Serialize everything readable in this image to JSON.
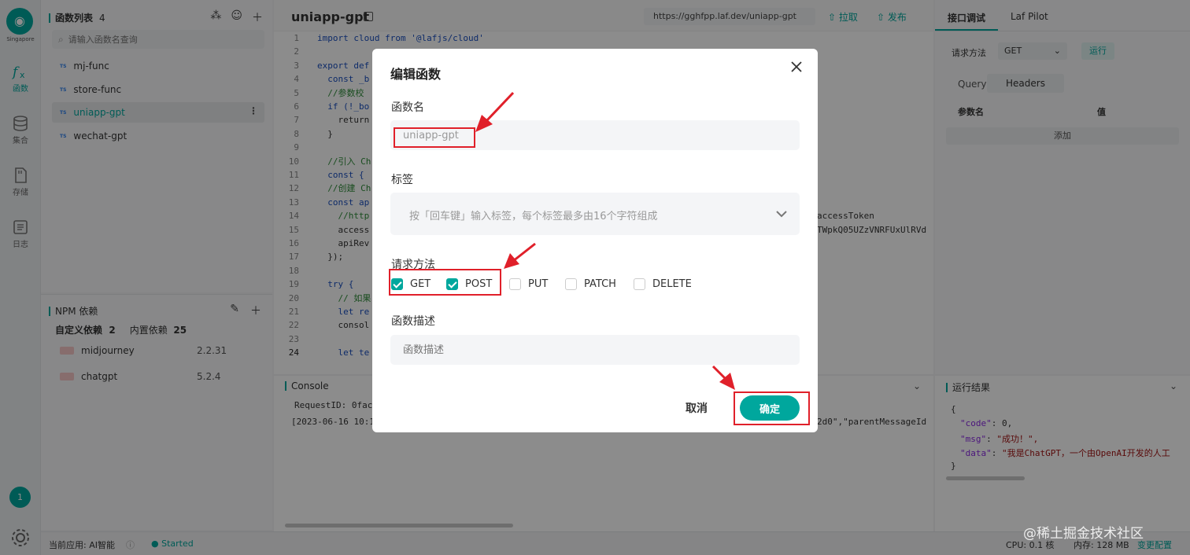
{
  "rail": {
    "region": "Singapore",
    "items": [
      {
        "label": "函数",
        "icon": "function-icon"
      },
      {
        "label": "集合",
        "icon": "database-icon"
      },
      {
        "label": "存储",
        "icon": "storage-icon"
      },
      {
        "label": "日志",
        "icon": "log-icon"
      }
    ],
    "badge": "1"
  },
  "functions": {
    "title": "函数列表",
    "count": "4",
    "search_placeholder": "请输入函数名查询",
    "items": [
      {
        "tag": "TS",
        "name": "mj-func"
      },
      {
        "tag": "TS",
        "name": "store-func"
      },
      {
        "tag": "TS",
        "name": "uniapp-gpt"
      },
      {
        "tag": "TS",
        "name": "wechat-gpt"
      }
    ]
  },
  "npm": {
    "title": "NPM 依赖",
    "custom_label": "自定义依赖",
    "custom_count": "2",
    "builtin_label": "内置依赖",
    "builtin_count": "25",
    "packages": [
      {
        "name": "midjourney",
        "version": "2.2.31"
      },
      {
        "name": "chatgpt",
        "version": "5.2.4"
      }
    ]
  },
  "editor": {
    "title": "uniapp-gpt",
    "url": "https://gghfpp.laf.dev/uniapp-gpt",
    "pull_label": "拉取",
    "publish_label": "发布",
    "line_numbers": [
      "1",
      "2",
      "3",
      "4",
      "5",
      "6",
      "7",
      "8",
      "9",
      "10",
      "11",
      "12",
      "13",
      "14",
      "15",
      "16",
      "17",
      "18",
      "19",
      "20",
      "21",
      "22",
      "23",
      "24"
    ],
    "lines": [
      "import cloud from '@lafjs/cloud'",
      "",
      "export def",
      "  const _b",
      "  //参数校",
      "  if (!_bo",
      "    return",
      "  }",
      "",
      "  //引入 Ch",
      "  const {",
      "  //创建 Ch",
      "  const ap",
      "    //http",
      "    access",
      "    apiRev",
      "  });",
      "",
      "  try {",
      "    // 如果",
      "    let re",
      "    consol",
      "",
      "    let te"
    ],
    "right_fragments": [
      "accessToken",
      "TWpkQ05UZzVNRFUxUlRVd"
    ]
  },
  "console": {
    "title": "Console",
    "line1": "RequestID: 0fac",
    "line2": "[2023-06-16 10:1",
    "line2_tail": "2d0\",\"parentMessageId"
  },
  "right": {
    "tab_debug": "接口调试",
    "tab_pilot": "Laf Pilot",
    "method_label": "请求方法",
    "method_value": "GET",
    "run_label": "运行",
    "tab_query": "Query",
    "tab_headers": "Headers",
    "col_param": "参数名",
    "col_value": "值",
    "add_label": "添加"
  },
  "result": {
    "title": "运行结果",
    "open": "{",
    "code_key": "\"code\"",
    "code_val": "0,",
    "msg_key": "\"msg\"",
    "msg_val": "\"成功！\",",
    "data_key": "\"data\"",
    "data_val": "\"我是ChatGPT，一个由OpenAI开发的人工",
    "close": "}"
  },
  "status": {
    "app_label": "当前应用: AI智能",
    "state": "Started",
    "cpu": "CPU: 0.1 核",
    "mem": "内存: 128 MB",
    "config": "变更配置"
  },
  "modal": {
    "title": "编辑函数",
    "name_label": "函数名",
    "name_value": "uniapp-gpt",
    "tag_label": "标签",
    "tag_placeholder": "按「回车键」输入标签，每个标签最多由16个字符组成",
    "method_label": "请求方法",
    "methods": [
      {
        "label": "GET",
        "checked": true
      },
      {
        "label": "POST",
        "checked": true
      },
      {
        "label": "PUT",
        "checked": false
      },
      {
        "label": "PATCH",
        "checked": false
      },
      {
        "label": "DELETE",
        "checked": false
      }
    ],
    "desc_label": "函数描述",
    "desc_placeholder": "函数描述",
    "cancel_label": "取消",
    "ok_label": "确定"
  },
  "watermark": "@稀土掘金技术社区",
  "colors": {
    "accent": "#00a79d",
    "annotation": "#e0202a"
  }
}
